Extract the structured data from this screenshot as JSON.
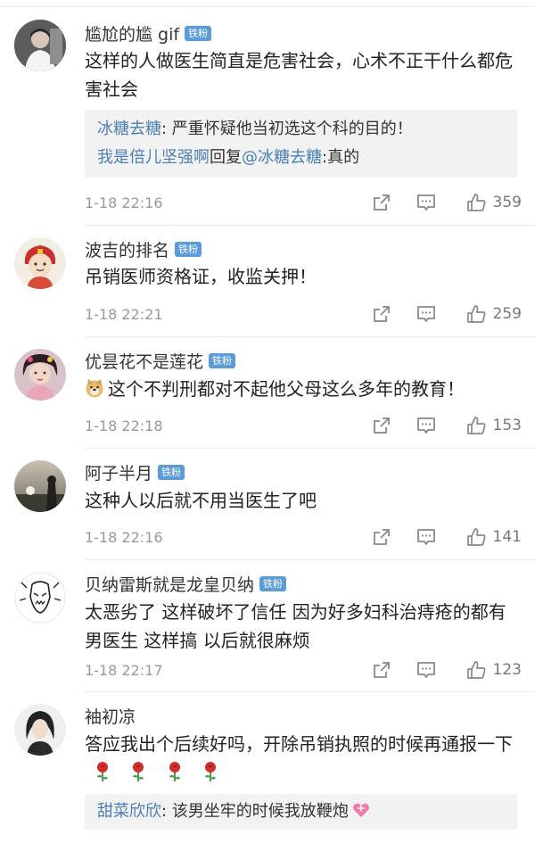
{
  "badge_label": "铁粉",
  "comments": [
    {
      "username": "尴尬的尴 gif",
      "has_badge": true,
      "text": "这样的人做医生简直是危害社会，心术不正干什么都危害社会",
      "replies": [
        {
          "name": "冰糖去糖",
          "text": ": 严重怀疑他当初选这个科的目的！"
        },
        {
          "name": "我是倍儿坚强啊",
          "mid": "回复",
          "target": "@冰糖去糖",
          "text": ":真的"
        }
      ],
      "time": "1-18 22:16",
      "likes": "359"
    },
    {
      "username": "波吉的排名",
      "has_badge": true,
      "text": "吊销医师资格证，收监关押！",
      "time": "1-18 22:21",
      "likes": "259"
    },
    {
      "username": "优昙花不是莲花",
      "has_badge": true,
      "text": "这个不判刑都对不起他父母这么多年的教育！",
      "time": "1-18 22:18",
      "likes": "153"
    },
    {
      "username": "阿子半月",
      "has_badge": true,
      "text": "这种人以后就不用当医生了吧",
      "time": "1-18 22:16",
      "likes": "141"
    },
    {
      "username": "贝纳雷斯就是龙皇贝纳",
      "has_badge": true,
      "text": "太恶劣了 这样破坏了信任 因为好多妇科治痔疮的都有男医生 这样搞 以后就很麻烦",
      "time": "1-18 22:17",
      "likes": "123"
    },
    {
      "username": "袖初凉",
      "has_badge": false,
      "text": "答应我出个后续好吗，开除吊销执照的时候再通报一下",
      "replies": [
        {
          "name": "甜菜欣欣",
          "text": ": 该男坐牢的时候我放鞭炮"
        }
      ]
    }
  ],
  "colors": {
    "link": "#4a7fb8",
    "badge": "#5b9bd8",
    "meta": "#999999"
  }
}
